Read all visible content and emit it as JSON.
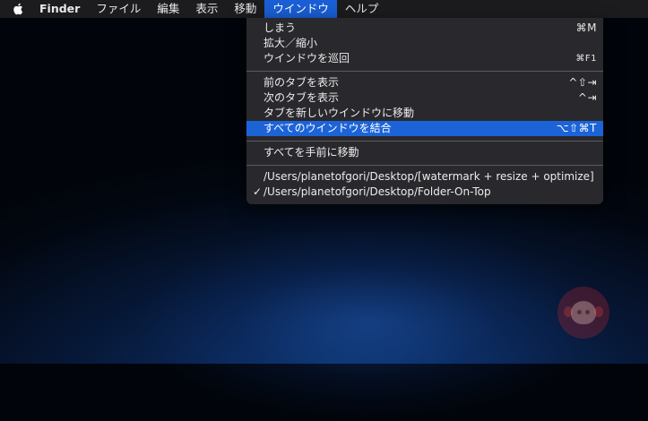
{
  "menubar": {
    "apple_icon": "apple-icon",
    "app_name": "Finder",
    "items": [
      "ファイル",
      "編集",
      "表示",
      "移動",
      "ウインドウ",
      "ヘルプ"
    ],
    "active_item": "ウインドウ"
  },
  "window_menu": {
    "items": [
      {
        "label": "しまう",
        "shortcut": "⌘M"
      },
      {
        "label": "拡大／縮小",
        "shortcut": ""
      },
      {
        "label": "ウインドウを巡回",
        "shortcut": "⌘F1"
      },
      {
        "label": "前のタブを表示",
        "shortcut": "^⇧⇥"
      },
      {
        "label": "次のタブを表示",
        "shortcut": "^⇥"
      },
      {
        "label": "タブを新しいウインドウに移動",
        "shortcut": ""
      },
      {
        "label": "すべてのウインドウを結合",
        "shortcut": "⌥⇧⌘T",
        "highlighted": true
      },
      {
        "label": "すべてを手前に移動",
        "shortcut": ""
      },
      {
        "label": "/Users/planetofgori/Desktop/[watermark + resize + optimize]",
        "shortcut": ""
      },
      {
        "label": "/Users/planetofgori/Desktop/Folder-On-Top",
        "shortcut": "",
        "checked": true
      }
    ],
    "check_mark": "✓"
  },
  "colors": {
    "menubar_bg": "#1c1c1e",
    "highlight": "#1c63d8",
    "menu_bg": "#2a2a2e"
  },
  "watermark": {
    "icon": "gorilla-logo"
  }
}
